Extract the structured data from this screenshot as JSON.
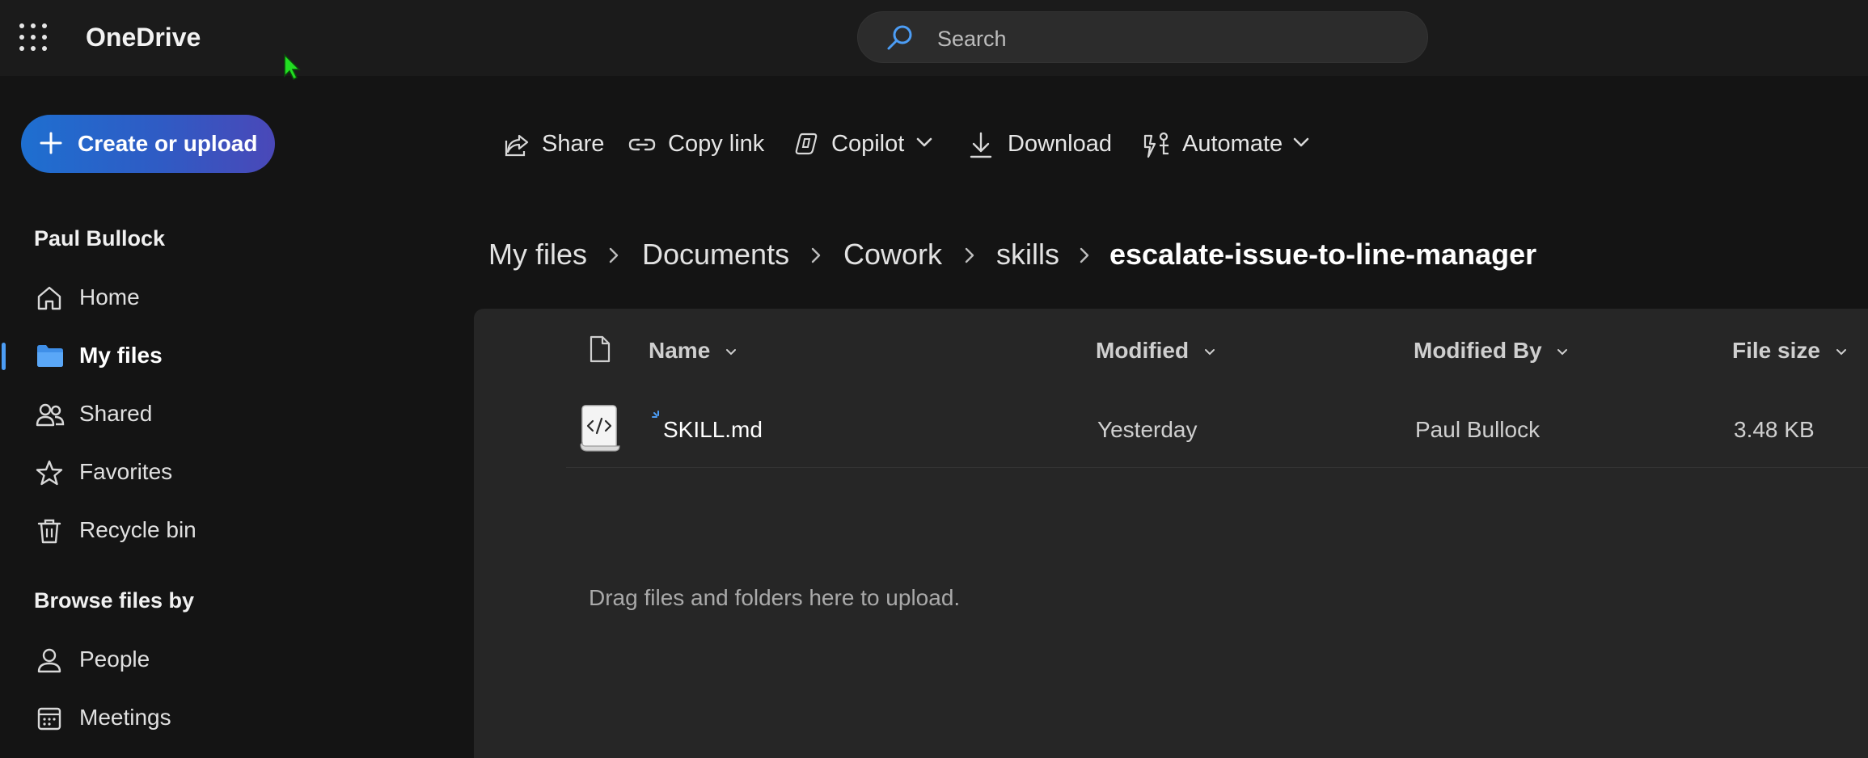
{
  "app": {
    "title": "OneDrive"
  },
  "search": {
    "placeholder": "Search"
  },
  "sidebar": {
    "create_label": "Create or upload",
    "user_name": "Paul Bullock",
    "nav": [
      {
        "label": "Home",
        "icon": "home-icon"
      },
      {
        "label": "My files",
        "icon": "folder-icon",
        "active": true
      },
      {
        "label": "Shared",
        "icon": "people-icon"
      },
      {
        "label": "Favorites",
        "icon": "star-icon"
      },
      {
        "label": "Recycle bin",
        "icon": "trash-icon"
      }
    ],
    "browse_heading": "Browse files by",
    "browse": [
      {
        "label": "People",
        "icon": "person-icon"
      },
      {
        "label": "Meetings",
        "icon": "calendar-icon"
      }
    ]
  },
  "commands": {
    "share": "Share",
    "copy_link": "Copy link",
    "copilot": "Copilot",
    "download": "Download",
    "automate": "Automate"
  },
  "breadcrumb": [
    "My files",
    "Documents",
    "Cowork",
    "skills",
    "escalate-issue-to-line-manager"
  ],
  "table": {
    "columns": {
      "name": "Name",
      "modified": "Modified",
      "modified_by": "Modified By",
      "file_size": "File size"
    },
    "rows": [
      {
        "name": "SKILL.md",
        "modified": "Yesterday",
        "modified_by": "Paul Bullock",
        "file_size": "3.48 KB",
        "icon": "code-file-icon"
      }
    ]
  },
  "empty_hint": "Drag files and folders here to upload.",
  "colors": {
    "accent": "#4c9df5",
    "background": "#141414",
    "panel": "#262626"
  }
}
